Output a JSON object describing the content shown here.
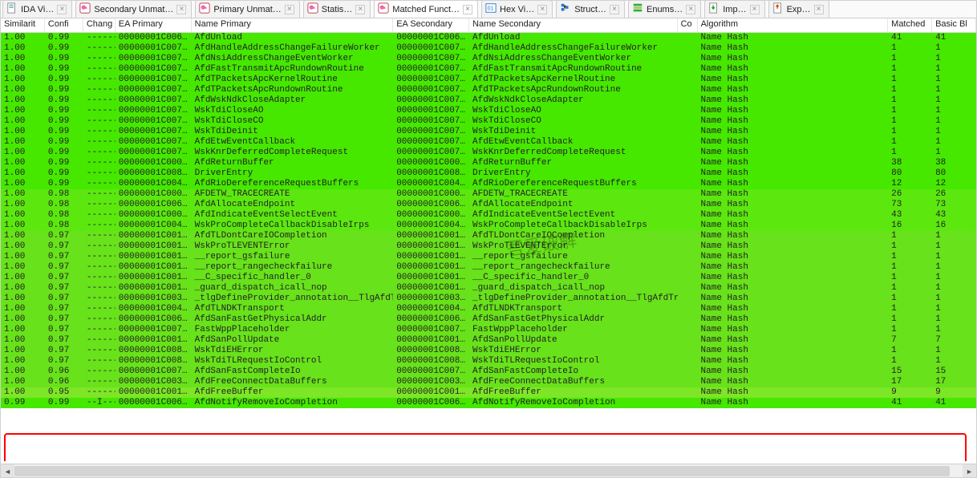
{
  "tabs": [
    {
      "icon": "doc",
      "title": "IDA Vi…"
    },
    {
      "icon": "bd",
      "title": "Secondary Unmat…"
    },
    {
      "icon": "bd",
      "title": "Primary Unmat…"
    },
    {
      "icon": "bd",
      "title": "Statis…"
    },
    {
      "icon": "bd",
      "title": "Matched Funct…",
      "active": true
    },
    {
      "icon": "hex",
      "title": "Hex Vi…"
    },
    {
      "icon": "struct",
      "title": "Struct…"
    },
    {
      "icon": "enum",
      "title": "Enums…"
    },
    {
      "icon": "imp",
      "title": "Imp…"
    },
    {
      "icon": "exp",
      "title": "Exp…"
    }
  ],
  "columns": [
    {
      "label": "Similarit",
      "w": "w0"
    },
    {
      "label": "Confi",
      "w": "w1"
    },
    {
      "label": "Chang",
      "w": "w2"
    },
    {
      "label": "EA Primary",
      "w": "w3"
    },
    {
      "label": "Name Primary",
      "w": "w4"
    },
    {
      "label": "EA Secondary",
      "w": "w5"
    },
    {
      "label": "Name Secondary",
      "w": "w6"
    },
    {
      "label": "Co",
      "w": "w7"
    },
    {
      "label": "Algorithm",
      "w": "w8"
    },
    {
      "label": "Matched",
      "w": "w9"
    },
    {
      "label": "Basic Bl",
      "w": "w10"
    }
  ],
  "rows": [
    {
      "s": "1.00",
      "c": "0.99",
      "ch": "-------",
      "ea1": "00000001C006…",
      "n1": "AfdUnload",
      "ea2": "00000001C006…",
      "n2": "AfdUnload",
      "alg": "Name Hash",
      "m": "41",
      "b": "41",
      "cls": ""
    },
    {
      "s": "1.00",
      "c": "0.99",
      "ch": "-------",
      "ea1": "00000001C007…",
      "n1": "AfdHandleAddressChangeFailureWorker",
      "ea2": "00000001C007…",
      "n2": "AfdHandleAddressChangeFailureWorker",
      "alg": "Name Hash",
      "m": "1",
      "b": "1",
      "cls": ""
    },
    {
      "s": "1.00",
      "c": "0.99",
      "ch": "-------",
      "ea1": "00000001C007…",
      "n1": "AfdNsiAddressChangeEventWorker",
      "ea2": "00000001C007…",
      "n2": "AfdNsiAddressChangeEventWorker",
      "alg": "Name Hash",
      "m": "1",
      "b": "1",
      "cls": ""
    },
    {
      "s": "1.00",
      "c": "0.99",
      "ch": "-------",
      "ea1": "00000001C007…",
      "n1": "AfdFastTransmitApcRundownRoutine",
      "ea2": "00000001C007…",
      "n2": "AfdFastTransmitApcRundownRoutine",
      "alg": "Name Hash",
      "m": "1",
      "b": "1",
      "cls": ""
    },
    {
      "s": "1.00",
      "c": "0.99",
      "ch": "-------",
      "ea1": "00000001C007…",
      "n1": "AfdTPacketsApcKernelRoutine",
      "ea2": "00000001C007…",
      "n2": "AfdTPacketsApcKernelRoutine",
      "alg": "Name Hash",
      "m": "1",
      "b": "1",
      "cls": ""
    },
    {
      "s": "1.00",
      "c": "0.99",
      "ch": "-------",
      "ea1": "00000001C007…",
      "n1": "AfdTPacketsApcRundownRoutine",
      "ea2": "00000001C007…",
      "n2": "AfdTPacketsApcRundownRoutine",
      "alg": "Name Hash",
      "m": "1",
      "b": "1",
      "cls": ""
    },
    {
      "s": "1.00",
      "c": "0.99",
      "ch": "-------",
      "ea1": "00000001C007…",
      "n1": "AfdWskNdkCloseAdapter",
      "ea2": "00000001C007…",
      "n2": "AfdWskNdkCloseAdapter",
      "alg": "Name Hash",
      "m": "1",
      "b": "1",
      "cls": ""
    },
    {
      "s": "1.00",
      "c": "0.99",
      "ch": "-------",
      "ea1": "00000001C007…",
      "n1": "WskTdiCloseAO",
      "ea2": "00000001C007…",
      "n2": "WskTdiCloseAO",
      "alg": "Name Hash",
      "m": "1",
      "b": "1",
      "cls": ""
    },
    {
      "s": "1.00",
      "c": "0.99",
      "ch": "-------",
      "ea1": "00000001C007…",
      "n1": "WskTdiCloseCO",
      "ea2": "00000001C007…",
      "n2": "WskTdiCloseCO",
      "alg": "Name Hash",
      "m": "1",
      "b": "1",
      "cls": ""
    },
    {
      "s": "1.00",
      "c": "0.99",
      "ch": "-------",
      "ea1": "00000001C007…",
      "n1": "WskTdiDeinit",
      "ea2": "00000001C007…",
      "n2": "WskTdiDeinit",
      "alg": "Name Hash",
      "m": "1",
      "b": "1",
      "cls": ""
    },
    {
      "s": "1.00",
      "c": "0.99",
      "ch": "-------",
      "ea1": "00000001C007…",
      "n1": "AfdEtwEventCallback",
      "ea2": "00000001C007…",
      "n2": "AfdEtwEventCallback",
      "alg": "Name Hash",
      "m": "1",
      "b": "1",
      "cls": ""
    },
    {
      "s": "1.00",
      "c": "0.99",
      "ch": "-------",
      "ea1": "00000001C007…",
      "n1": "WskKnrDeferredCompleteRequest",
      "ea2": "00000001C007…",
      "n2": "WskKnrDeferredCompleteRequest",
      "alg": "Name Hash",
      "m": "1",
      "b": "1",
      "cls": ""
    },
    {
      "s": "1.00",
      "c": "0.99",
      "ch": "-------",
      "ea1": "00000001C000…",
      "n1": "AfdReturnBuffer",
      "ea2": "00000001C000…",
      "n2": "AfdReturnBuffer",
      "alg": "Name Hash",
      "m": "38",
      "b": "38",
      "cls": ""
    },
    {
      "s": "1.00",
      "c": "0.99",
      "ch": "-------",
      "ea1": "00000001C008…",
      "n1": "DriverEntry",
      "ea2": "00000001C008…",
      "n2": "DriverEntry",
      "alg": "Name Hash",
      "m": "80",
      "b": "80",
      "cls": ""
    },
    {
      "s": "1.00",
      "c": "0.99",
      "ch": "-------",
      "ea1": "00000001C004…",
      "n1": "AfdRioDereferenceRequestBuffers",
      "ea2": "00000001C004…",
      "n2": "AfdRioDereferenceRequestBuffers",
      "alg": "Name Hash",
      "m": "12",
      "b": "12",
      "cls": ""
    },
    {
      "s": "1.00",
      "c": "0.98",
      "ch": "-------",
      "ea1": "00000001C000…",
      "n1": "AFDETW_TRACECREATE",
      "ea2": "00000001C000…",
      "n2": "AFDETW_TRACECREATE",
      "alg": "Name Hash",
      "m": "26",
      "b": "26",
      "cls": "g98"
    },
    {
      "s": "1.00",
      "c": "0.98",
      "ch": "-------",
      "ea1": "00000001C006…",
      "n1": "AfdAllocateEndpoint",
      "ea2": "00000001C006…",
      "n2": "AfdAllocateEndpoint",
      "alg": "Name Hash",
      "m": "73",
      "b": "73",
      "cls": "g98"
    },
    {
      "s": "1.00",
      "c": "0.98",
      "ch": "-------",
      "ea1": "00000001C000…",
      "n1": "AfdIndicateEventSelectEvent",
      "ea2": "00000001C000…",
      "n2": "AfdIndicateEventSelectEvent",
      "alg": "Name Hash",
      "m": "43",
      "b": "43",
      "cls": "g98"
    },
    {
      "s": "1.00",
      "c": "0.98",
      "ch": "-------",
      "ea1": "00000001C004…",
      "n1": "WskProCompleteCallbackDisableIrps",
      "ea2": "00000001C004…",
      "n2": "WskProCompleteCallbackDisableIrps",
      "alg": "Name Hash",
      "m": "16",
      "b": "16",
      "cls": "g98"
    },
    {
      "s": "1.00",
      "c": "0.97",
      "ch": "-------",
      "ea1": "00000001C001…",
      "n1": "AfdTLDontCareIOCompletion",
      "ea2": "00000001C001…",
      "n2": "AfdTLDontCareIOCompletion",
      "alg": "Name Hash",
      "m": "1",
      "b": "1",
      "cls": "g97"
    },
    {
      "s": "1.00",
      "c": "0.97",
      "ch": "-------",
      "ea1": "00000001C001…",
      "n1": "WskProTLEVENTError",
      "ea2": "00000001C001…",
      "n2": "WskProTLEVENTError",
      "alg": "Name Hash",
      "m": "1",
      "b": "1",
      "cls": "g97"
    },
    {
      "s": "1.00",
      "c": "0.97",
      "ch": "-------",
      "ea1": "00000001C001…",
      "n1": "__report_gsfailure",
      "ea2": "00000001C001…",
      "n2": "__report_gsfailure",
      "alg": "Name Hash",
      "m": "1",
      "b": "1",
      "cls": "g97"
    },
    {
      "s": "1.00",
      "c": "0.97",
      "ch": "-------",
      "ea1": "00000001C001…",
      "n1": "__report_rangecheckfailure",
      "ea2": "00000001C001…",
      "n2": "__report_rangecheckfailure",
      "alg": "Name Hash",
      "m": "1",
      "b": "1",
      "cls": "g97"
    },
    {
      "s": "1.00",
      "c": "0.97",
      "ch": "-------",
      "ea1": "00000001C001…",
      "n1": "__C_specific_handler_0",
      "ea2": "00000001C001…",
      "n2": "__C_specific_handler_0",
      "alg": "Name Hash",
      "m": "1",
      "b": "1",
      "cls": "g97"
    },
    {
      "s": "1.00",
      "c": "0.97",
      "ch": "-------",
      "ea1": "00000001C001…",
      "n1": "_guard_dispatch_icall_nop",
      "ea2": "00000001C001…",
      "n2": "_guard_dispatch_icall_nop",
      "alg": "Name Hash",
      "m": "1",
      "b": "1",
      "cls": "g97"
    },
    {
      "s": "1.00",
      "c": "0.97",
      "ch": "-------",
      "ea1": "00000001C003…",
      "n1": "_tlgDefineProvider_annotation__TlgAfdTr…",
      "ea2": "00000001C003…",
      "n2": "_tlgDefineProvider_annotation__TlgAfdTr…",
      "alg": "Name Hash",
      "m": "1",
      "b": "1",
      "cls": "g97"
    },
    {
      "s": "1.00",
      "c": "0.97",
      "ch": "-------",
      "ea1": "00000001C004…",
      "n1": "AfdTLNDKTransport",
      "ea2": "00000001C004…",
      "n2": "AfdTLNDKTransport",
      "alg": "Name Hash",
      "m": "1",
      "b": "1",
      "cls": "g97"
    },
    {
      "s": "1.00",
      "c": "0.97",
      "ch": "-------",
      "ea1": "00000001C006…",
      "n1": "AfdSanFastGetPhysicalAddr",
      "ea2": "00000001C006…",
      "n2": "AfdSanFastGetPhysicalAddr",
      "alg": "Name Hash",
      "m": "1",
      "b": "1",
      "cls": "g97"
    },
    {
      "s": "1.00",
      "c": "0.97",
      "ch": "-------",
      "ea1": "00000001C007…",
      "n1": "FastWppPlaceholder",
      "ea2": "00000001C007…",
      "n2": "FastWppPlaceholder",
      "alg": "Name Hash",
      "m": "1",
      "b": "1",
      "cls": "g97"
    },
    {
      "s": "1.00",
      "c": "0.97",
      "ch": "-------",
      "ea1": "00000001C001…",
      "n1": "AfdSanPollUpdate",
      "ea2": "00000001C001…",
      "n2": "AfdSanPollUpdate",
      "alg": "Name Hash",
      "m": "7",
      "b": "7",
      "cls": "g97"
    },
    {
      "s": "1.00",
      "c": "0.97",
      "ch": "-------",
      "ea1": "00000001C008…",
      "n1": "WskTdiEHError",
      "ea2": "00000001C008…",
      "n2": "WskTdiEHError",
      "alg": "Name Hash",
      "m": "1",
      "b": "1",
      "cls": "g97"
    },
    {
      "s": "1.00",
      "c": "0.97",
      "ch": "-------",
      "ea1": "00000001C008…",
      "n1": "WskTdiTLRequestIoControl",
      "ea2": "00000001C008…",
      "n2": "WskTdiTLRequestIoControl",
      "alg": "Name Hash",
      "m": "1",
      "b": "1",
      "cls": "g97"
    },
    {
      "s": "1.00",
      "c": "0.96",
      "ch": "-------",
      "ea1": "00000001C007…",
      "n1": "AfdSanFastCompleteIo",
      "ea2": "00000001C007…",
      "n2": "AfdSanFastCompleteIo",
      "alg": "Name Hash",
      "m": "15",
      "b": "15",
      "cls": "g97"
    },
    {
      "s": "1.00",
      "c": "0.96",
      "ch": "-------",
      "ea1": "00000001C003…",
      "n1": "AfdFreeConnectDataBuffers",
      "ea2": "00000001C003…",
      "n2": "AfdFreeConnectDataBuffers",
      "alg": "Name Hash",
      "m": "17",
      "b": "17",
      "cls": "g97"
    },
    {
      "s": "1.00",
      "c": "0.95",
      "ch": "-------",
      "ea1": "00000001C001…",
      "n1": "AfdFreeBuffer",
      "ea2": "00000001C001…",
      "n2": "AfdFreeBuffer",
      "alg": "Name Hash",
      "m": "9",
      "b": "9",
      "cls": "g95"
    },
    {
      "s": "0.99",
      "c": "0.99",
      "ch": "--I----",
      "ea1": "00000001C006…",
      "n1": "AfdNotifyRemoveIoCompletion",
      "ea2": "00000001C006…",
      "n2": "AfdNotifyRemoveIoCompletion",
      "alg": "Name Hash",
      "m": "41",
      "b": "41",
      "cls": ""
    }
  ],
  "watermark": "吾爱破解"
}
